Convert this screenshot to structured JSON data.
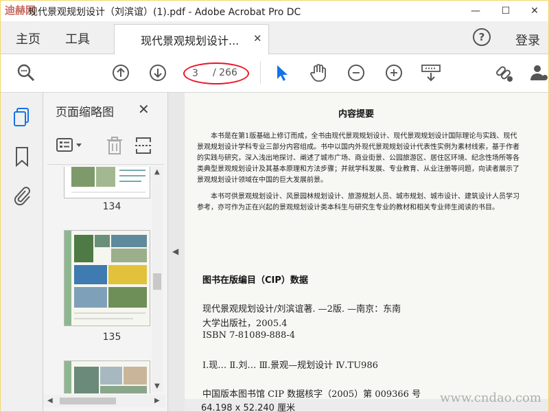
{
  "window": {
    "title": "现代景观规划设计（刘滨谊）(1).pdf - Adobe Acrobat Pro DC",
    "logo_text": "迪赫网",
    "minimize_glyph": "—",
    "maximize_glyph": "☐",
    "close_glyph": "✕"
  },
  "menu": {
    "home": "主页",
    "tools": "工具"
  },
  "tab": {
    "label": "现代景观规划设计...",
    "close_glyph": "✕"
  },
  "header": {
    "help_glyph": "?",
    "login": "登录"
  },
  "toolbar": {
    "current_page": "3",
    "total_pages": "/ 266",
    "icons": [
      "search-zoom-icon",
      "prev-page-icon",
      "next-page-icon",
      "select-cursor-icon",
      "hand-tool-icon",
      "zoom-out-icon",
      "zoom-in-icon",
      "keyboard-icon",
      "link-share-icon",
      "user-share-icon"
    ]
  },
  "panel": {
    "title": "页面缩略图",
    "close_glyph": "✕",
    "thumbnails": [
      {
        "page_label": "134"
      },
      {
        "page_label": "135"
      }
    ]
  },
  "document": {
    "heading": "内容提要",
    "para1": "本书是在第1版基础上修订而成，全书由现代景观规划设计、现代景观规划设计国际理论与实践、现代景观规划设计学科专业三部分内容组成。书中以国内外现代景观规划设计代表性实例为素材线索，基于作者的实践与研究，深入浅出地探讨、阐述了城市广场、商业街景、公园旅游区、居住区环境、纪念性场所等各类典型景观规划设计及其基本原理和方法步骤；并就学科发展、专业教育、从业注册等问题，向读者展示了景观规划设计领域在中国的巨大发展前景。",
    "para2": "本书可供景观规划设计、风景园林规划设计、旅游规划人员、城市规划、城市设计、建筑设计人员学习参考，亦可作为正在兴起的景观规划设计类本科生与研究生专业的教材和相关专业师生阅读的书目。",
    "cip_title": "图书在版编目（CIP）数据",
    "cip_line1": "现代景观规划设计/刘滨谊著. —2版. —南京：东南",
    "cip_line2": "大学出版社，2005.4",
    "cip_line3": "ISBN 7-81089-888-4",
    "cip_line4": "Ⅰ.现…  Ⅱ.刘…  Ⅲ.景观—规划设计  Ⅳ.TU986",
    "cip_line5": "中国版本图书馆 CIP 数据核字（2005）第 009366 号"
  },
  "status": {
    "page_size": "64.198 x 52.240 厘米"
  },
  "watermark": "www.cndao.com",
  "colors": {
    "accent_blue": "#1473e6",
    "annotation_red": "#e11"
  }
}
